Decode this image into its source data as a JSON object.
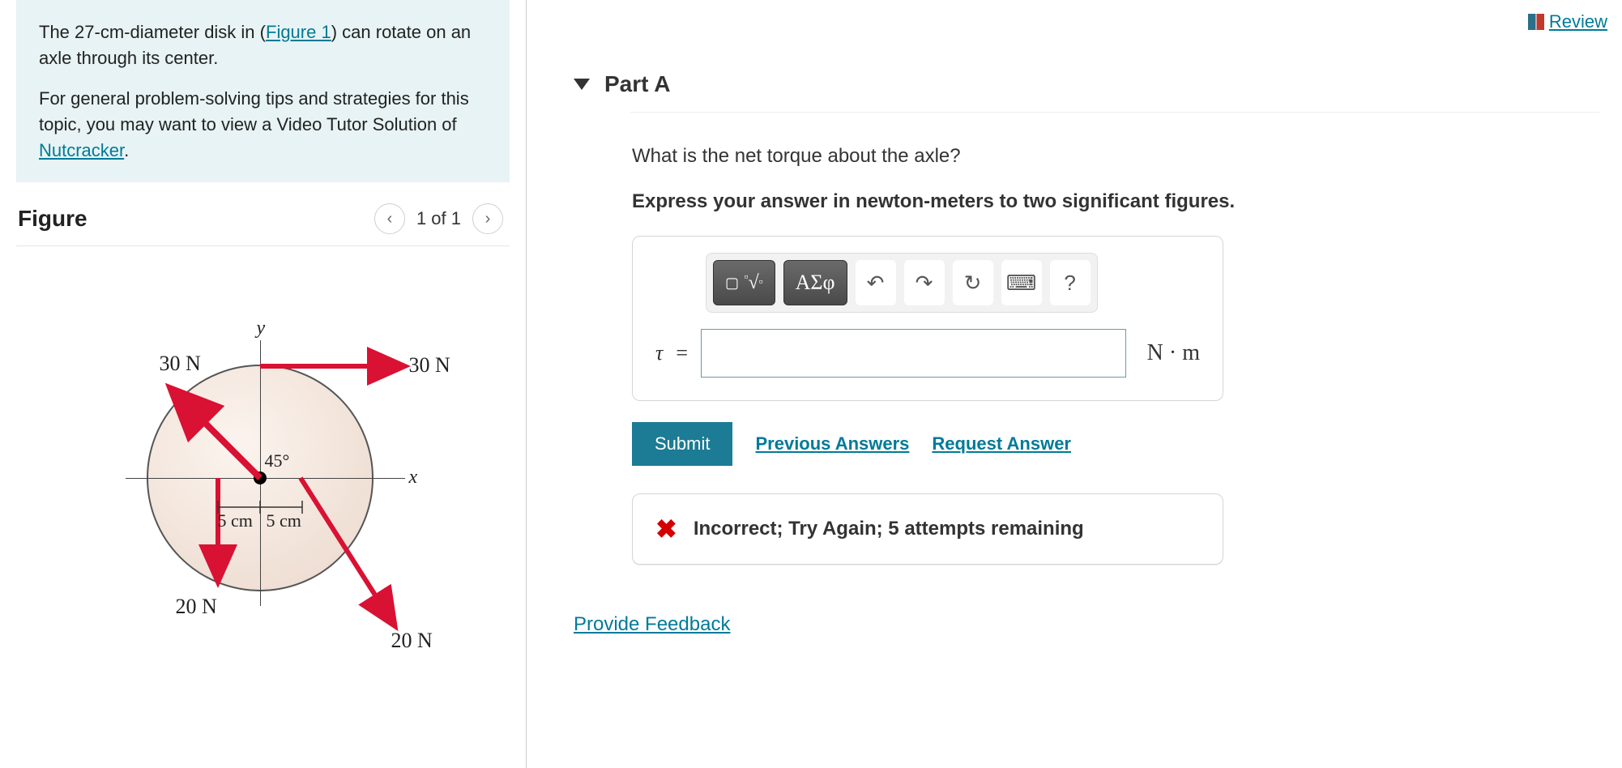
{
  "problem": {
    "diameter": "27-cm",
    "intro1_pre": "The ",
    "intro1_mid": "-diameter disk in (",
    "figlink": "Figure 1",
    "intro1_post": ") can rotate on an axle through its center.",
    "intro2_pre": "For general problem-solving tips and strategies for this topic, you may want to view a Video Tutor Solution of ",
    "tutorlink": "Nutcracker",
    "period": "."
  },
  "figure": {
    "title": "Figure",
    "count": "1 of 1",
    "labels": {
      "y": "y",
      "x": "x",
      "angle": "45°",
      "dim_left": "5 cm",
      "dim_right": "5 cm",
      "f_top_left": "30 N",
      "f_top_right": "30 N",
      "f_bot_left": "20 N",
      "f_bot_right": "20 N"
    }
  },
  "review": "Review",
  "part": {
    "title": "Part A",
    "question": "What is the net torque about the axle?",
    "directive": "Express your answer in newton-meters to two significant figures.",
    "toolbar": {
      "templates": "■ √□",
      "greek": "ΑΣφ",
      "undo": "↶",
      "redo": "↷",
      "reset": "↻",
      "keyboard": "⌨",
      "help": "?"
    },
    "eqn": {
      "var": "τ",
      "eq": "=",
      "unit": "N · m"
    },
    "value": "",
    "submit": "Submit",
    "prev": "Previous Answers",
    "request": "Request Answer",
    "feedback": "Incorrect; Try Again; 5 attempts remaining"
  },
  "provide": "Provide Feedback"
}
